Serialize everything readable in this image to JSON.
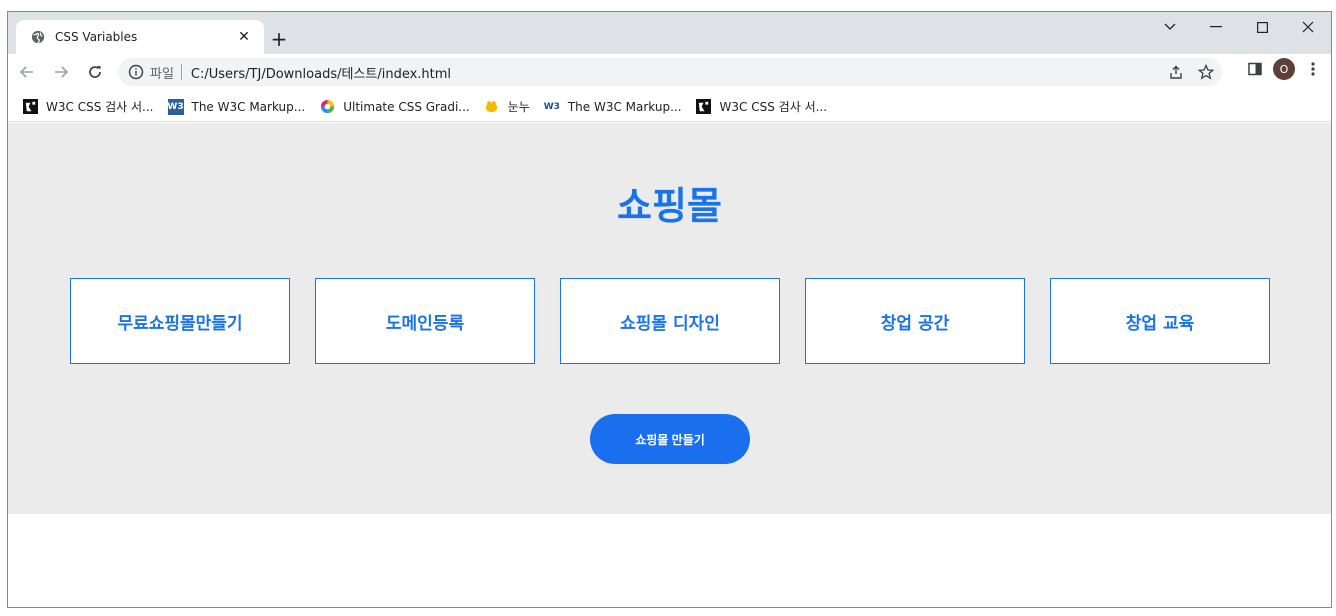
{
  "tab": {
    "title": "CSS Variables",
    "close": "✕",
    "new_tab": "+"
  },
  "window_controls": {
    "tab_search": "⌄",
    "minimize": "—",
    "maximize": "☐",
    "close": "✕"
  },
  "omnibox": {
    "scheme_label": "파일",
    "url": "C:/Users/TJ/Downloads/테스트/index.html"
  },
  "profile": {
    "initial": "O"
  },
  "bookmarks": [
    {
      "label": "W3C CSS 검사 서...",
      "icon": "w3c-validator-icon"
    },
    {
      "label": "The W3C Markup...",
      "icon": "w3c-icon"
    },
    {
      "label": "Ultimate CSS Gradi...",
      "icon": "gradient-icon"
    },
    {
      "label": "눈누",
      "icon": "noonnu-icon"
    },
    {
      "label": "The W3C Markup...",
      "icon": "w3-icon"
    },
    {
      "label": "W3C CSS 검사 서...",
      "icon": "w3c-validator-icon"
    }
  ],
  "page": {
    "title": "쇼핑몰",
    "menu": [
      "무료쇼핑몰만들기",
      "도메인등록",
      "쇼핑몰 디자인",
      "창업 공간",
      "창업 교육"
    ],
    "cta": "쇼핑몰 만들기"
  },
  "colors": {
    "accent": "#1a73e8",
    "hero_bg": "#ebebeb",
    "button_bg": "#1a6fef"
  }
}
